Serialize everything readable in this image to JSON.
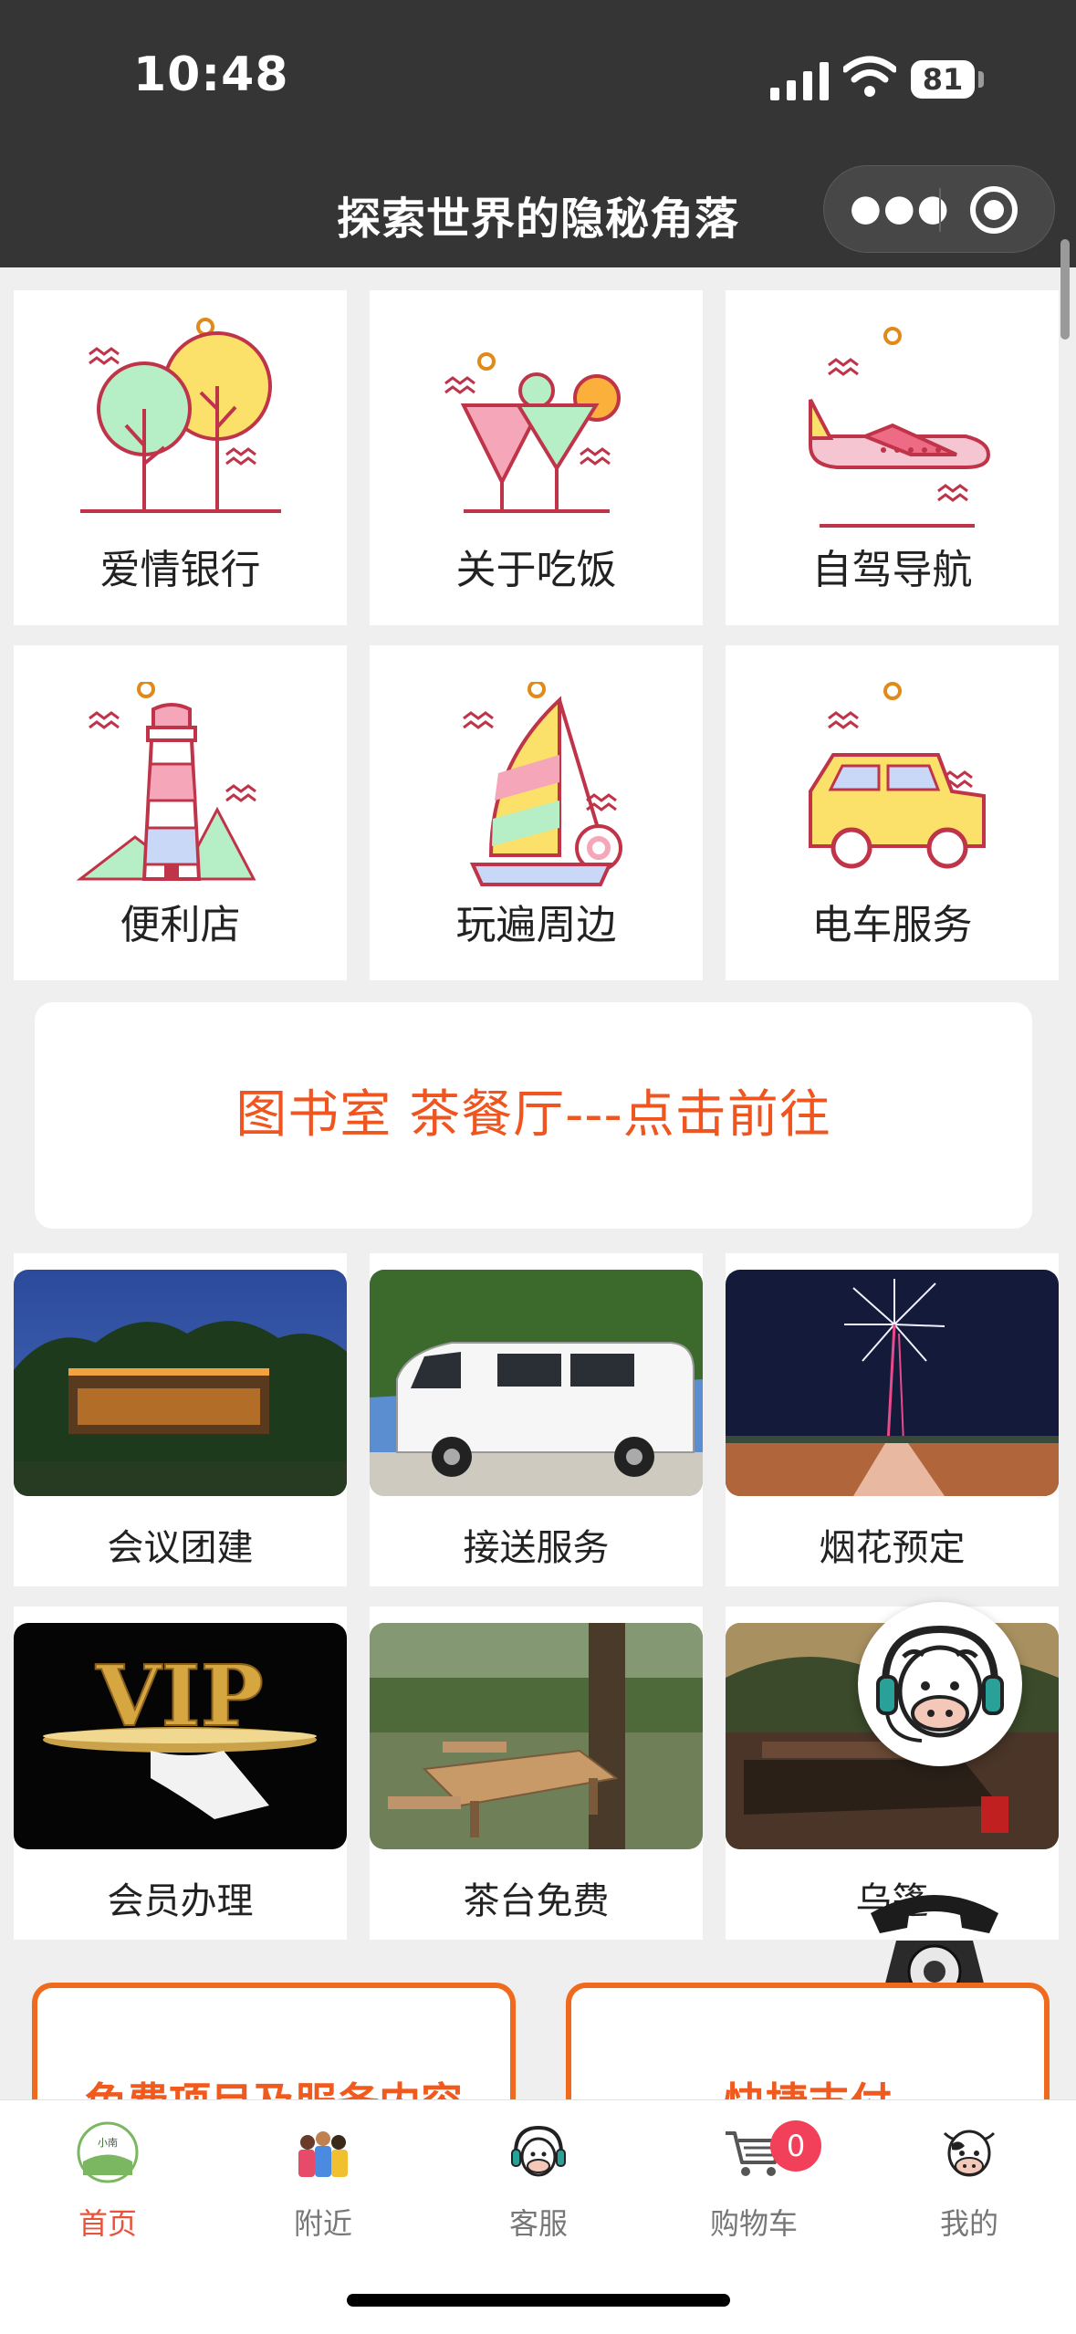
{
  "status_bar": {
    "time": "10:48",
    "battery": "81"
  },
  "nav": {
    "title": "探索世界的隐秘角落",
    "more_icon": "more-dots-icon",
    "close_icon": "record-close-icon"
  },
  "features": [
    {
      "label": "爱情银行",
      "icon": "trees-icon"
    },
    {
      "label": "关于吃饭",
      "icon": "cocktail-icon"
    },
    {
      "label": "自驾导航",
      "icon": "airplane-icon"
    },
    {
      "label": "便利店",
      "icon": "lighthouse-icon"
    },
    {
      "label": "玩遍周边",
      "icon": "sailboat-icon"
    },
    {
      "label": "电车服务",
      "icon": "jeep-icon"
    }
  ],
  "banner": {
    "text": "图书室 茶餐厅---点击前往"
  },
  "services": [
    {
      "label": "会议团建"
    },
    {
      "label": "接送服务"
    },
    {
      "label": "烟花预定"
    },
    {
      "label": "会员办理",
      "image_text": "VIP"
    },
    {
      "label": "茶台免费"
    },
    {
      "label": "乌篷"
    }
  ],
  "cards": [
    {
      "title": "免费项目及服务内容"
    },
    {
      "title": "快捷支付"
    }
  ],
  "tabbar": [
    {
      "label": "首页",
      "icon": "home-logo-icon",
      "active": true
    },
    {
      "label": "附近",
      "icon": "nearby-people-icon"
    },
    {
      "label": "客服",
      "icon": "customer-service-icon"
    },
    {
      "label": "购物车",
      "icon": "shopping-cart-icon",
      "badge": "0"
    },
    {
      "label": "我的",
      "icon": "cow-avatar-icon"
    }
  ],
  "colors": {
    "accent": "#f05a1e",
    "tab_active": "#e8533a",
    "header": "#353535"
  }
}
